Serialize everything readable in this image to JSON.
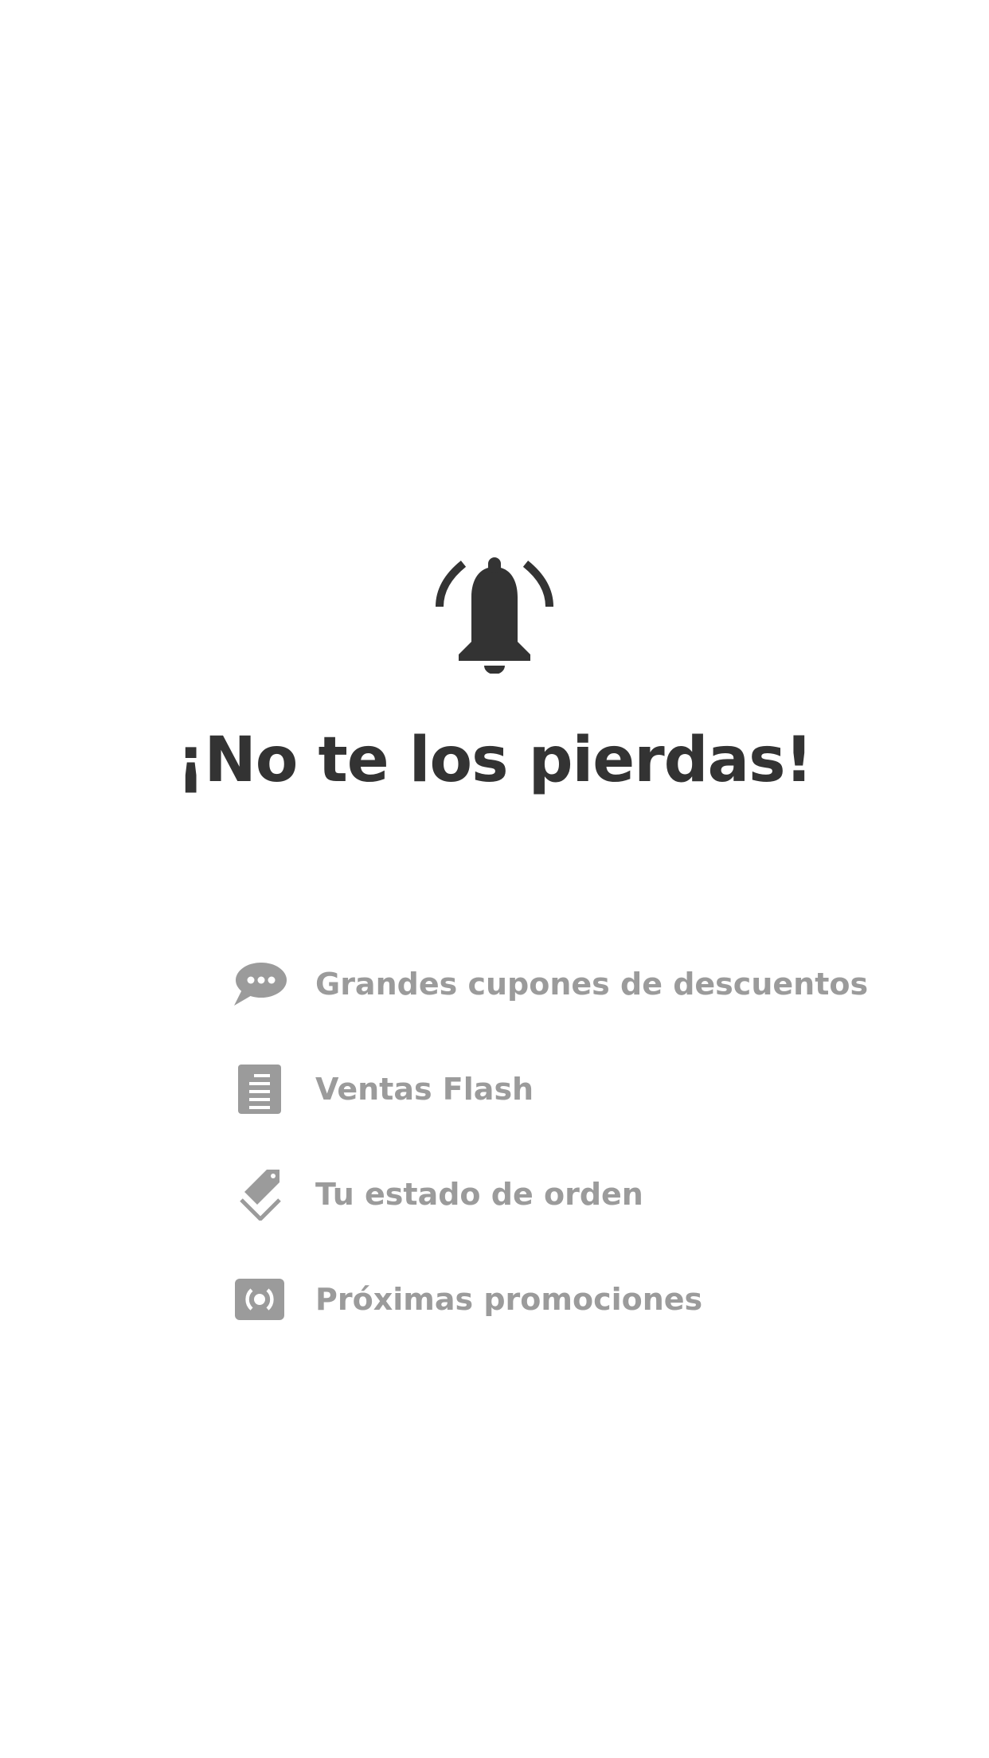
{
  "hero": {
    "icon": "bell-ringing-icon",
    "title": "¡No te los pierdas!"
  },
  "features": [
    {
      "icon": "chat-bubble-icon",
      "label": "Grandes cupones de descuentos"
    },
    {
      "icon": "document-icon",
      "label": "Ventas Flash"
    },
    {
      "icon": "tags-icon",
      "label": "Tu estado de orden"
    },
    {
      "icon": "broadcast-icon",
      "label": "Próximas promociones"
    }
  ],
  "colors": {
    "title": "#333333",
    "feature_text": "#9b9b9b",
    "icon_dark": "#333333",
    "icon_muted": "#9b9b9b",
    "background": "#ffffff"
  }
}
